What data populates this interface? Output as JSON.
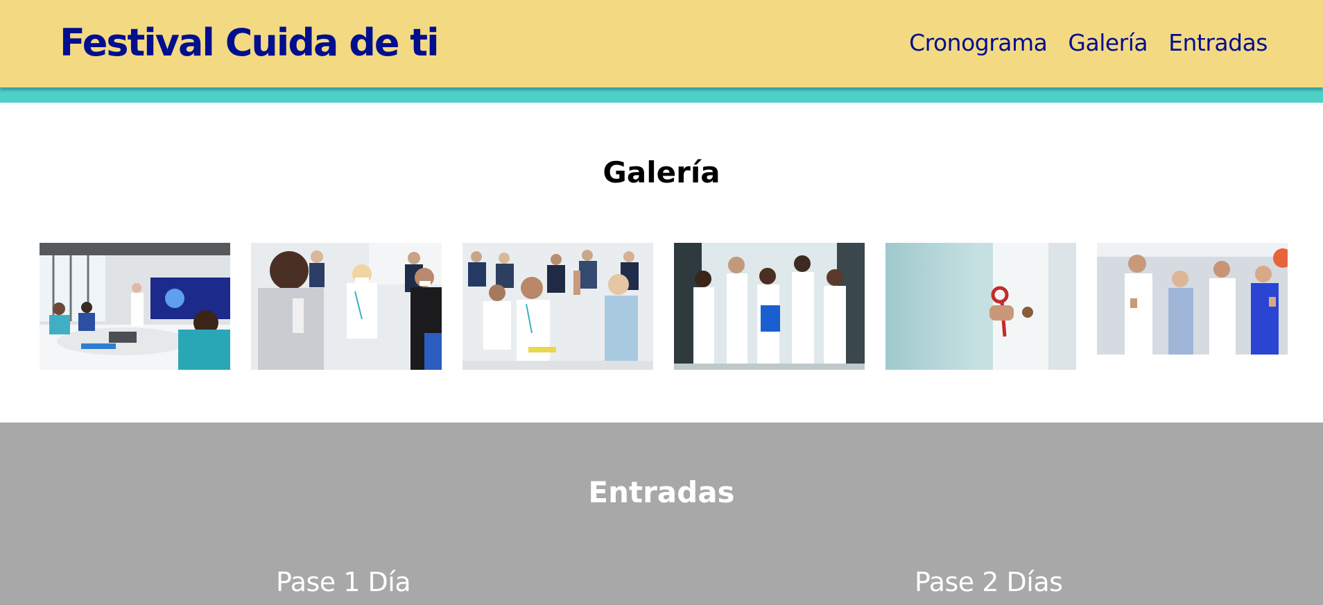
{
  "header": {
    "brand": "Festival Cuida de ti",
    "nav": [
      {
        "label": "Cronograma"
      },
      {
        "label": "Galería"
      },
      {
        "label": "Entradas"
      }
    ]
  },
  "gallery": {
    "title": "Galería",
    "photos": [
      {
        "subject": "medical team meeting in a conference room with a presentation screen"
      },
      {
        "subject": "doctors in masks at a seminar with a raised hand"
      },
      {
        "subject": "smiling doctor raising hand in a seminar audience"
      },
      {
        "subject": "group of medical staff in white coats standing in a hallway"
      },
      {
        "subject": "doctor in a white coat holding a red stethoscope"
      },
      {
        "subject": "medical team giving thumbs up in a hospital corridor"
      }
    ]
  },
  "tickets": {
    "title": "Entradas",
    "passes": [
      {
        "name": "Pase 1 Día"
      },
      {
        "name": "Pase 2 Días"
      }
    ]
  },
  "colors": {
    "header_bg": "#f4d983",
    "accent_stripe": "#4dd0c8",
    "brand_text": "#000f8e",
    "tickets_bg": "#a8a8a8"
  }
}
